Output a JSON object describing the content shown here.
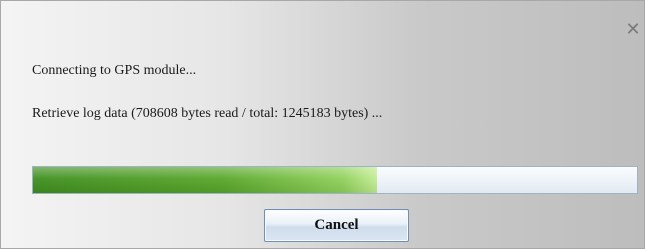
{
  "dialog": {
    "close_glyph": "✕",
    "status_connecting": "Connecting to GPS module...",
    "status_retrieve": "Retrieve log data (708608 bytes read / total: 1245183 bytes) ...",
    "progress": {
      "bytes_read": 708608,
      "bytes_total": 1245183,
      "fill_color_start": "#3f8f1f",
      "fill_color_end": "#c2ec92"
    },
    "cancel_label": "Cancel"
  }
}
